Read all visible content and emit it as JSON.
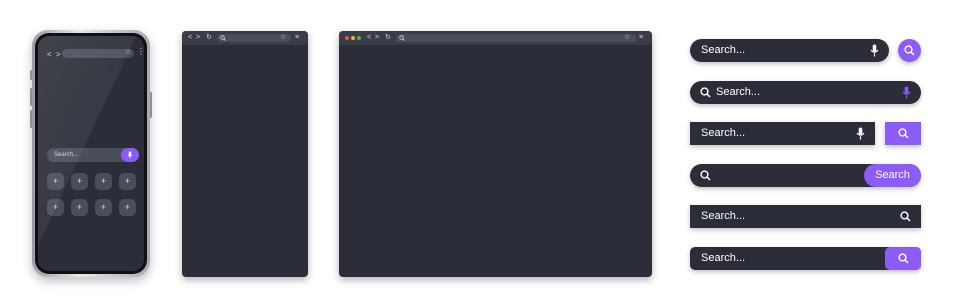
{
  "accent_color": "#8b5cf6",
  "surface_color": "#2b2e38",
  "phone": {
    "nav_glyph": "< >",
    "menu_glyph": "⋮",
    "search_placeholder": "Search...",
    "app_tiles": [
      "+",
      "+",
      "+",
      "+",
      "+",
      "+",
      "+",
      "+"
    ]
  },
  "tablet_browser": {
    "nav_glyph": "< >"
  },
  "desktop_browser": {
    "nav_glyph": "< >",
    "window_dots": [
      "#e5534b",
      "#e2b93d",
      "#4caf50"
    ]
  },
  "search_bars": [
    {
      "placeholder": "Search...",
      "style": "pill with mic icon and separate round search button"
    },
    {
      "placeholder": "Search...",
      "style": "pill with leading search icon and purple mic icon"
    },
    {
      "placeholder": "Search...",
      "style": "square with mic icon and separate square search button"
    },
    {
      "placeholder": "",
      "button_label": "Search",
      "style": "pill with leading search icon and purple text button"
    },
    {
      "placeholder": "Search...",
      "style": "square with trailing search icon"
    },
    {
      "placeholder": "Search...",
      "style": "rounded with purple search button"
    }
  ]
}
